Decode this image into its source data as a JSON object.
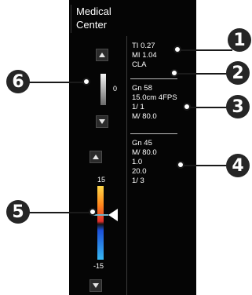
{
  "header": {
    "title_line1": "Medical",
    "title_line2": "Center"
  },
  "acoustic": {
    "ti": "TI 0.27",
    "mi": "MI 1.04",
    "preset": "CLA"
  },
  "bmode": {
    "gain": "Gn 58",
    "depth_fps": "15.0cm 4FPS",
    "ratio": "1/ 1",
    "map": "M/ 80.0"
  },
  "color_mode": {
    "gain": "Gn 45",
    "map": "M/ 80.0",
    "v1": "1.0",
    "v2": "20.0",
    "v3": "1/ 3"
  },
  "gray_scale": {
    "value": "0"
  },
  "color_scale": {
    "max": "15",
    "min": "-15"
  },
  "callouts": {
    "c1": "1",
    "c2": "2",
    "c3": "3",
    "c4": "4",
    "c5": "5",
    "c6": "6"
  },
  "colors": {
    "background": "#050505",
    "callout_badge": "#262626",
    "text": "#ffffff"
  }
}
